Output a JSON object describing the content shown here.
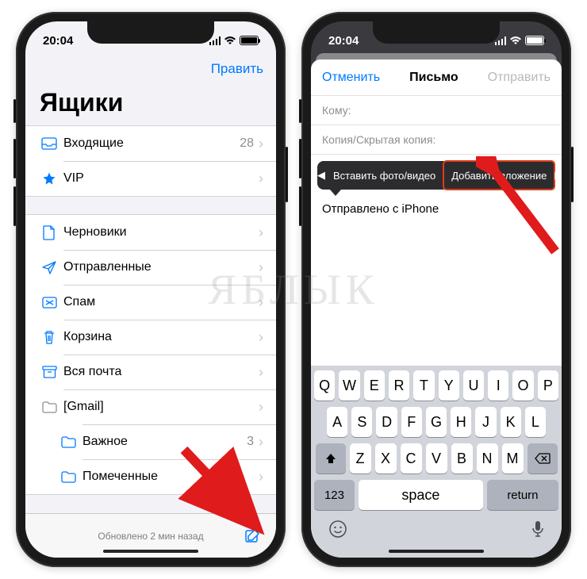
{
  "watermark": "ЯБЛЫК",
  "phone1": {
    "time": "20:04",
    "edit": "Править",
    "title": "Ящики",
    "rows": {
      "inbox": {
        "label": "Входящие",
        "count": "28"
      },
      "vip": {
        "label": "VIP"
      },
      "drafts": {
        "label": "Черновики"
      },
      "sent": {
        "label": "Отправленные"
      },
      "spam": {
        "label": "Спам"
      },
      "trash": {
        "label": "Корзина"
      },
      "allmail": {
        "label": "Вся почта"
      },
      "gmail": {
        "label": "[Gmail]"
      },
      "important": {
        "label": "Важное",
        "count": "3"
      },
      "starred": {
        "label": "Помеченные"
      }
    },
    "status": "Обновлено 2 мин назад"
  },
  "phone2": {
    "time": "20:04",
    "cancel": "Отменить",
    "title": "Письмо",
    "send": "Отправить",
    "to_label": "Кому:",
    "cc_label": "Копия/Скрытая копия:",
    "callout": {
      "insert": "Вставить фото/видео",
      "attach": "Добавить вложение"
    },
    "signature": "Отправлено с iPhone",
    "keyboard": {
      "r1": [
        "Q",
        "W",
        "E",
        "R",
        "T",
        "Y",
        "U",
        "I",
        "O",
        "P"
      ],
      "r2": [
        "A",
        "S",
        "D",
        "F",
        "G",
        "H",
        "J",
        "K",
        "L"
      ],
      "r3": [
        "Z",
        "X",
        "C",
        "V",
        "B",
        "N",
        "M"
      ],
      "num": "123",
      "space": "space",
      "return": "return"
    }
  }
}
